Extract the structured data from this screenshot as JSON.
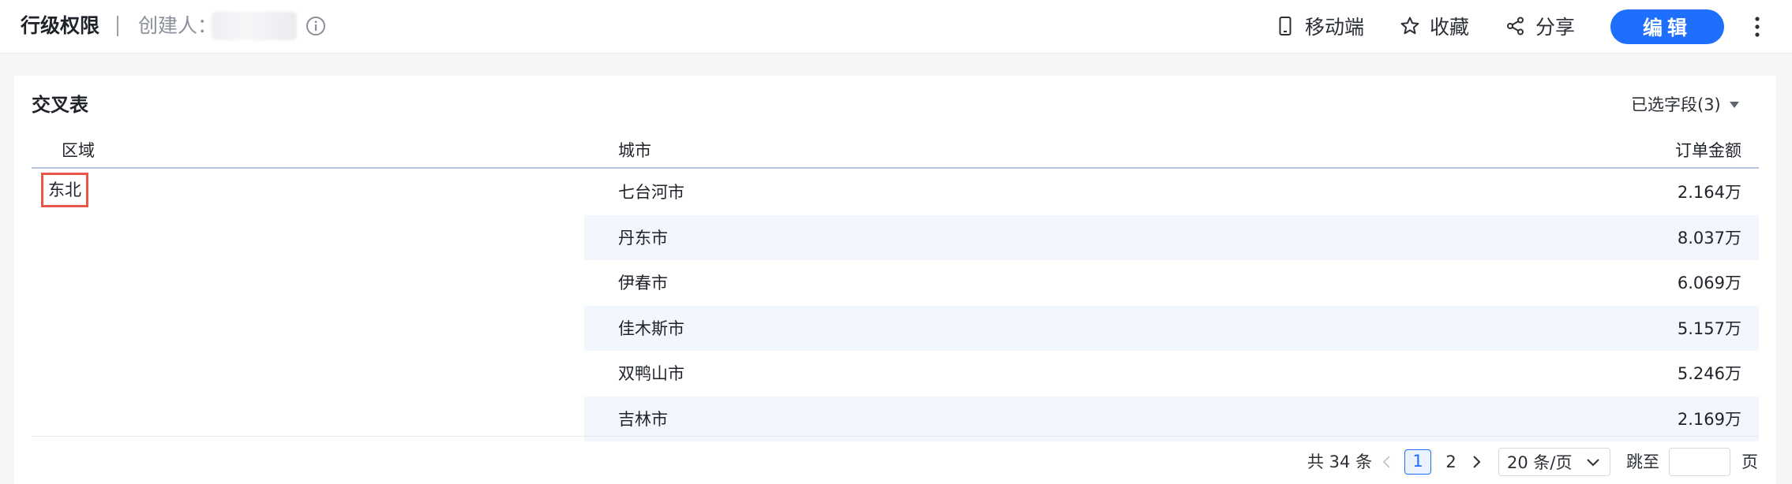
{
  "header": {
    "title": "行级权限",
    "creator_label": "创建人：",
    "actions": {
      "mobile": "移动端",
      "favorite": "收藏",
      "share": "分享",
      "edit": "编辑"
    }
  },
  "card": {
    "title": "交叉表",
    "field_select": "已选字段(3)",
    "columns": {
      "region": "区域",
      "city": "城市",
      "amount": "订单金额"
    },
    "region_value": "东北",
    "rows": [
      {
        "city": "七台河市",
        "amount": "2.164万"
      },
      {
        "city": "丹东市",
        "amount": "8.037万"
      },
      {
        "city": "伊春市",
        "amount": "6.069万"
      },
      {
        "city": "佳木斯市",
        "amount": "5.157万"
      },
      {
        "city": "双鸭山市",
        "amount": "5.246万"
      },
      {
        "city": "吉林市",
        "amount": "2.169万"
      }
    ]
  },
  "pagination": {
    "total": "共 34 条",
    "pages": [
      "1",
      "2"
    ],
    "current_page": "1",
    "page_size": "20 条/页",
    "jump_label": "跳至",
    "jump_value": "",
    "page_unit": "页"
  },
  "colors": {
    "primary": "#1f6fff",
    "row_alt": "#f2f6fd",
    "highlight_border": "#e8564a"
  }
}
